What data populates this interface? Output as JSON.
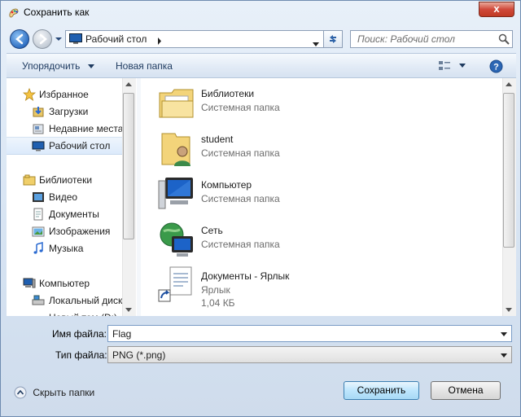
{
  "window": {
    "title": "Сохранить как",
    "close_label": "x"
  },
  "address": {
    "location": "Рабочий стол"
  },
  "search": {
    "placeholder": "Поиск: Рабочий стол"
  },
  "toolbar": {
    "organize_label": "Упорядочить",
    "new_folder_label": "Новая папка"
  },
  "sidebar": {
    "favorites_label": "Избранное",
    "items": [
      {
        "label": "Загрузки",
        "icon": "downloads-icon"
      },
      {
        "label": "Недавние места",
        "icon": "recent-places-icon"
      },
      {
        "label": "Рабочий стол",
        "icon": "desktop-icon"
      }
    ],
    "libraries_label": "Библиотеки",
    "libraries": [
      {
        "label": "Видео",
        "icon": "video-icon"
      },
      {
        "label": "Документы",
        "icon": "documents-icon"
      },
      {
        "label": "Изображения",
        "icon": "pictures-icon"
      },
      {
        "label": "Музыка",
        "icon": "music-icon"
      }
    ],
    "computer_label": "Компьютер",
    "computer": [
      {
        "label": "Локальный диск",
        "icon": "drive-icon"
      },
      {
        "label": "Новый том (D:)",
        "icon": "drive-icon"
      }
    ]
  },
  "files": [
    {
      "name": "Библиотеки",
      "type": "Системная папка",
      "icon": "libraries-folder-icon"
    },
    {
      "name": "student",
      "type": "Системная папка",
      "icon": "user-folder-icon"
    },
    {
      "name": "Компьютер",
      "type": "Системная папка",
      "icon": "computer-icon"
    },
    {
      "name": "Сеть",
      "type": "Системная папка",
      "icon": "network-icon"
    },
    {
      "name": "Документы - Ярлык",
      "type": "Ярлык",
      "size": "1,04 КБ",
      "icon": "shortcut-icon"
    }
  ],
  "form": {
    "filename_label": "Имя файла:",
    "filename_value": "Flag",
    "filetype_label": "Тип файла:",
    "filetype_value": "PNG (*.png)"
  },
  "footer": {
    "hide_folders_label": "Скрыть папки",
    "save_label": "Сохранить",
    "cancel_label": "Отмена"
  }
}
